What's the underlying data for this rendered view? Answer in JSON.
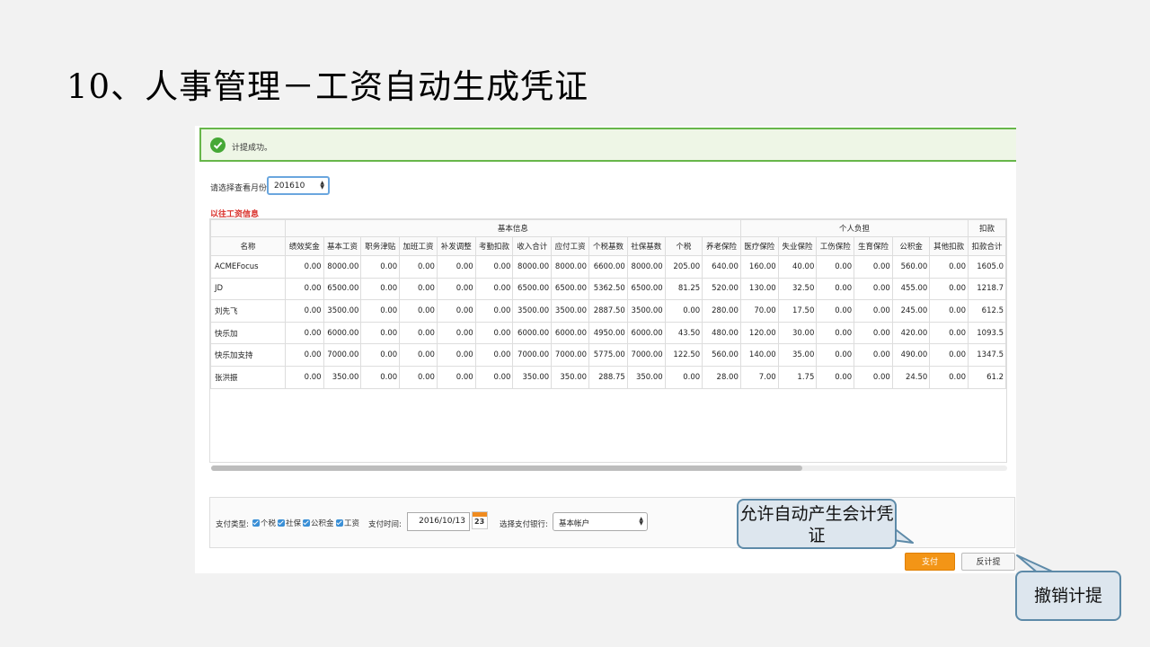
{
  "slide": {
    "title": "10、人事管理－工资自动生成凭证"
  },
  "alert": {
    "message": "计提成功。"
  },
  "filter": {
    "month_label": "请选择查看月份",
    "month_value": "201610"
  },
  "section": {
    "title": "以往工资信息"
  },
  "table": {
    "groups": [
      {
        "label": "基本信息",
        "span": 13
      },
      {
        "label": "个人负担",
        "span": 6
      },
      {
        "label": "扣款",
        "span": 2
      }
    ],
    "columns": [
      "名称",
      "绩效奖金",
      "基本工资",
      "职务津贴",
      "加班工资",
      "补发调整",
      "考勤扣款",
      "收入合计",
      "应付工资",
      "个税基数",
      "社保基数",
      "个税",
      "养老保险",
      "医疗保险",
      "失业保险",
      "工伤保险",
      "生育保险",
      "公积金",
      "其他扣款",
      "扣款合计"
    ],
    "rows": [
      [
        "ACMEFocus",
        "0.00",
        "8000.00",
        "0.00",
        "0.00",
        "0.00",
        "0.00",
        "8000.00",
        "8000.00",
        "6600.00",
        "8000.00",
        "205.00",
        "640.00",
        "160.00",
        "40.00",
        "0.00",
        "0.00",
        "560.00",
        "0.00",
        "1605.0"
      ],
      [
        "JD",
        "0.00",
        "6500.00",
        "0.00",
        "0.00",
        "0.00",
        "0.00",
        "6500.00",
        "6500.00",
        "5362.50",
        "6500.00",
        "81.25",
        "520.00",
        "130.00",
        "32.50",
        "0.00",
        "0.00",
        "455.00",
        "0.00",
        "1218.7"
      ],
      [
        "刘先飞",
        "0.00",
        "3500.00",
        "0.00",
        "0.00",
        "0.00",
        "0.00",
        "3500.00",
        "3500.00",
        "2887.50",
        "3500.00",
        "0.00",
        "280.00",
        "70.00",
        "17.50",
        "0.00",
        "0.00",
        "245.00",
        "0.00",
        "612.5"
      ],
      [
        "快乐加",
        "0.00",
        "6000.00",
        "0.00",
        "0.00",
        "0.00",
        "0.00",
        "6000.00",
        "6000.00",
        "4950.00",
        "6000.00",
        "43.50",
        "480.00",
        "120.00",
        "30.00",
        "0.00",
        "0.00",
        "420.00",
        "0.00",
        "1093.5"
      ],
      [
        "快乐加支持",
        "0.00",
        "7000.00",
        "0.00",
        "0.00",
        "0.00",
        "0.00",
        "7000.00",
        "7000.00",
        "5775.00",
        "7000.00",
        "122.50",
        "560.00",
        "140.00",
        "35.00",
        "0.00",
        "0.00",
        "490.00",
        "0.00",
        "1347.5"
      ],
      [
        "张洪振",
        "0.00",
        "350.00",
        "0.00",
        "0.00",
        "0.00",
        "0.00",
        "350.00",
        "350.00",
        "288.75",
        "350.00",
        "0.00",
        "28.00",
        "7.00",
        "1.75",
        "0.00",
        "0.00",
        "24.50",
        "0.00",
        "61.2"
      ]
    ]
  },
  "payment": {
    "type_label": "支付类型:",
    "types": [
      "个税",
      "社保",
      "公积金",
      "工资"
    ],
    "time_label": "支付时间:",
    "date_value": "2016/10/13",
    "calendar_day": "23",
    "bank_label": "选择支付银行:",
    "bank_value": "基本帐户",
    "pay_label": "支付",
    "reverse_label": "反计提"
  },
  "callouts": {
    "auto": "允许自动产生会计凭证",
    "undo": "撤销计提"
  },
  "colors": {
    "accent": "#f39516",
    "success": "#46a836",
    "section_title": "#d9302a",
    "callout_border": "#5d8aa8"
  }
}
